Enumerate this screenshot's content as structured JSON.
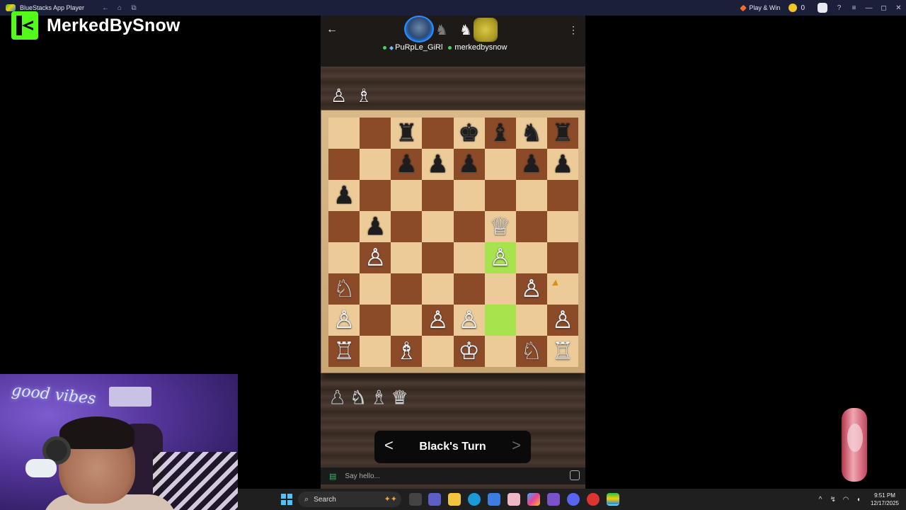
{
  "titlebar": {
    "app_title": "BlueStacks App Player",
    "nav": {
      "back": "←",
      "home": "⌂",
      "recents": "⧉"
    },
    "play_label": "Play & Win",
    "coins": "0",
    "icons": {
      "account": "avatar",
      "help": "?",
      "menu": "≡",
      "minimize": "—",
      "restore": "◻",
      "close": "✕"
    }
  },
  "brand": {
    "name": "MerkedBySnow"
  },
  "game": {
    "back_glyph": "←",
    "menu_glyph": "⋮",
    "player1": {
      "name": "PuRpLe_GiRl"
    },
    "player2": {
      "name": "merkedbysnow"
    },
    "captured_top": [
      "♙",
      "♗"
    ],
    "captured_bottom": [
      "♟",
      "♞",
      "♝",
      "♛"
    ],
    "board": [
      [
        "",
        "",
        "♜",
        "",
        "♚",
        "♝",
        "♞",
        "♜"
      ],
      [
        "",
        "",
        "♟",
        "♟",
        "♟",
        "",
        "♟",
        "♟"
      ],
      [
        "♟",
        "",
        "",
        "",
        "",
        "",
        "",
        ""
      ],
      [
        "",
        "♟",
        "",
        "",
        "",
        "♕",
        "",
        ""
      ],
      [
        "",
        "♙",
        "",
        "",
        "",
        "♙",
        "",
        ""
      ],
      [
        "♘",
        "",
        "",
        "",
        "",
        "",
        "♙",
        ""
      ],
      [
        "♙",
        "",
        "",
        "♙",
        "♙",
        "",
        "",
        "♙"
      ],
      [
        "♖",
        "",
        "♗",
        "",
        "♔",
        "",
        "♘",
        "♖"
      ]
    ],
    "highlighted_squares": [
      "4-5",
      "6-5"
    ],
    "turn": {
      "label": "Black's Turn",
      "prev": "<",
      "next": ">"
    },
    "chat": {
      "placeholder": "Say hello..."
    }
  },
  "webcam": {
    "neon_text": "good vibes"
  },
  "taskbar": {
    "search_label": "Search",
    "time": "9:51 PM",
    "date": "12/17/2025"
  }
}
